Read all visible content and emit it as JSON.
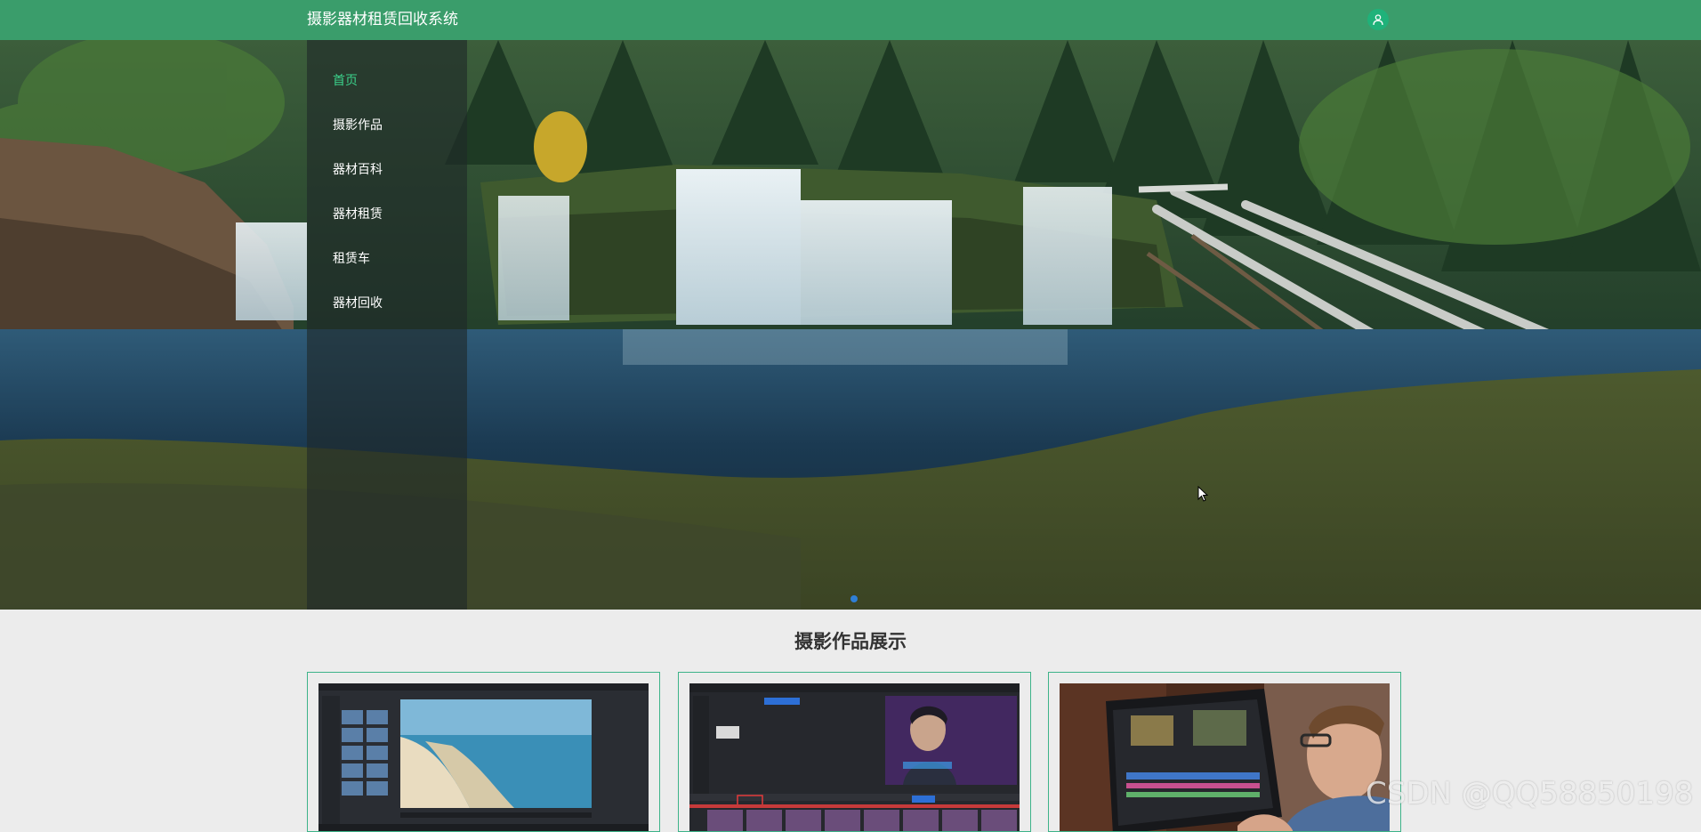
{
  "header": {
    "title": "摄影器材租赁回收系统",
    "user_icon": "user-icon"
  },
  "menu": {
    "items": [
      {
        "label": "首页",
        "active": true
      },
      {
        "label": "摄影作品",
        "active": false
      },
      {
        "label": "器材百科",
        "active": false
      },
      {
        "label": "器材租赁",
        "active": false
      },
      {
        "label": "租赁车",
        "active": false
      },
      {
        "label": "器材回收",
        "active": false
      }
    ]
  },
  "section": {
    "title": "摄影作品展示"
  },
  "watermark": "CSDN @QQ58850198",
  "colors": {
    "header_bg": "#3a9d6b",
    "accent": "#3bd28b",
    "card_border": "#3db389",
    "page_bg": "#ececec"
  }
}
